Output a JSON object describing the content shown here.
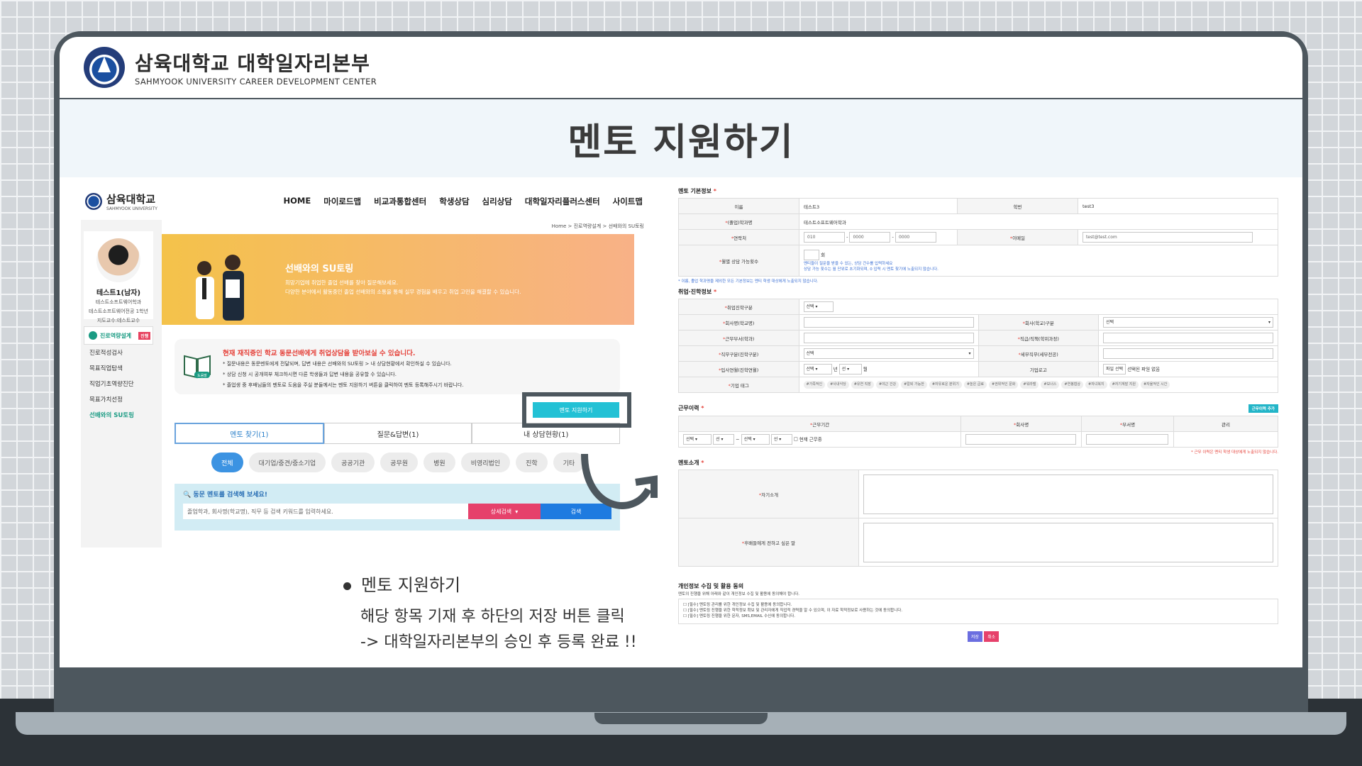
{
  "header": {
    "brand_ko": "삼육대학교 대학일자리본부",
    "brand_en": "SAHMYOOK UNIVERSITY CAREER DEVELOPMENT CENTER"
  },
  "title": "멘토 지원하기",
  "left": {
    "logo_ko": "삼육대학교",
    "logo_en": "SAHMYOOK UNIVERSITY",
    "menu": [
      "HOME",
      "마이로드맵",
      "비교과통합센터",
      "학생상담",
      "심리상담",
      "대학일자리플러스센터",
      "사이트맵"
    ],
    "breadcrumb": "Home > 진로역량설계 > 선배와의 SU토링",
    "profile": {
      "name": "테스트1(남자)",
      "dept1": "테스트소프트웨어학과",
      "dept2": "테스트소프트웨어전공 1학년",
      "advisor": "지도교수:테스트교수"
    },
    "side": {
      "head": "진로역량설계",
      "badge": "진행",
      "items": [
        "진로적성검사",
        "목표직업탐색",
        "직업기초역량진단",
        "목표가치선정",
        "선배와의 SU토링"
      ]
    },
    "hero": {
      "title": "선배와의 SU토링",
      "desc1": "희망기업에 취업한 졸업 선배를 찾아 질문해보세요.",
      "desc2": "다양한 분야에서 활동중인 졸업 선배와의 소통을 통해 실무 경험을 배우고 취업 고민을 해결할 수 있습니다."
    },
    "notice": {
      "title": "현재 재직중인 학교 동문선배에게 취업상담을 받아보실 수 있습니다.",
      "lines": [
        "* 질문내용은 동문멘토에게 전달되며, 답변 내용은 선배와의 SU토링 > 내 상담현황에서 확인하실 수 있습니다.",
        "* 상담 신청 시 공개여부 체크하시면 다른 학생들과 답변 내용을 공유할 수 있습니다.",
        "* 졸업생 중 후배님들의 멘토로 도움을 주실 분들께서는 멘토 지원하기 버튼을 클릭하여 멘토 등록해주시기 바랍니다."
      ],
      "book_label": "도움말"
    },
    "apply_btn": "멘토 지원하기",
    "tabs": [
      "멘토 찾기(1)",
      "질문&답변(1)",
      "내 상담현황(1)"
    ],
    "pills": [
      "전체",
      "대기업/중견/중소기업",
      "공공기관",
      "공무원",
      "병원",
      "비영리법인",
      "진학",
      "기타"
    ],
    "search": {
      "label": "동문 멘토를 검색해 보세요!",
      "placeholder": "졸업학과, 회사명(학교명), 직무 등 검색 키워드를 입력하세요.",
      "detail": "상세검색",
      "button": "검색"
    }
  },
  "caption": {
    "title": "멘토 지원하기",
    "line1": "해당 항목 기재 후 하단의 저장 버튼 클릭",
    "line2": "-> 대학일자리본부의 승인 후 등록 완료 !!"
  },
  "form": {
    "s1": "멘토 기본정보",
    "name_label": "이름",
    "name_value": "테스트3",
    "id_label": "학번",
    "id_value": "test3",
    "major_label": "(졸업)학과명",
    "major_value": "테스트소프트웨어학과",
    "phone_label": "연락처",
    "phone": [
      "010",
      "0000",
      "0000"
    ],
    "email_label": "이메일",
    "email_value": "test@test.com",
    "count_label": "월별 상담 가능횟수",
    "count_unit": "회",
    "count_note1": "멘티들이 질문을 받을 수 있는, 상담 건수를 입력하세요",
    "count_note2": "상담 가능 횟수는 월 단위로 초기화되며, 0 입력 시 멘토 찾기에 노출되지 않습니다.",
    "note1": "* 이름, 졸업 학과명을 제외한 모든 기본정보는 멘티 학생 대상에게 노출되지 않습니다.",
    "s2": "취업·진학정보",
    "jobtype_label": "취업진학구분",
    "jobtype_value": "선택",
    "company_label": "회사명(학교명)",
    "ctype_label": "회사(학교)구분",
    "ctype_value": "선택",
    "dept_label": "근무부서(학과)",
    "pos_label": "직급/직책(학위과정)",
    "duty_label": "직무구분(진학구분)",
    "duty_value": "선택",
    "duty2_label": "세부직무(세부전공)",
    "join_label": "입사연월(진학연월)",
    "join_value1": "선택",
    "join_year": "년",
    "join_value2": "선",
    "join_month": "월",
    "logo_label": "기업로고",
    "logo_btn": "파일 선택",
    "logo_text": "선택된 파일 없음",
    "tag_label": "기업 태그",
    "tags": [
      "#가족적인",
      "#사내식당",
      "#유연 직장",
      "#야근 건강",
      "#칼퇴 가능한",
      "#자유로운 분위기",
      "#높은 급료",
      "#권위적인 문화",
      "#워라밸",
      "#보너스",
      "#연봉협상",
      "#자녀복지",
      "#자기계발 지원",
      "#자율적인 시간"
    ],
    "s3": "근무이력",
    "add_btn": "근무이력 추가",
    "hist_cols": [
      "근무기간",
      "회사명",
      "부서명",
      "관리"
    ],
    "hist_sel": [
      "선택",
      "선",
      "선택",
      "선"
    ],
    "hist_current": "현재 근무중",
    "hist_note": "* 근무 이력은 멘티 학생 대상에게 노출되지 않습니다.",
    "s4": "멘토소개",
    "intro_label": "자기소개",
    "msg_label": "후배들에게 전하고 싶은 말",
    "s5": "개인정보 수집 및 활용 동의",
    "priv_intro": "멘토의 진행을 위해 아래와 같이 개인정보 수집 및 활용에 동의해야 합니다.",
    "priv": [
      "[필수] 멘토링 관리를 위한 개인정보 수집 및 활용에 동의합니다.",
      "[필수] 멘토링 진행을 위한 학적정보 확보 및 관리자에게 직업적 경력을 알 수 있으며, 이 자료 학적정보로 사용하는 것에 동의합니다.",
      "[필수] 멘토링 진행을 위한 문자, SMS,EMAIL 수신에 동의합니다."
    ],
    "save": "저장",
    "cancel": "취소"
  }
}
